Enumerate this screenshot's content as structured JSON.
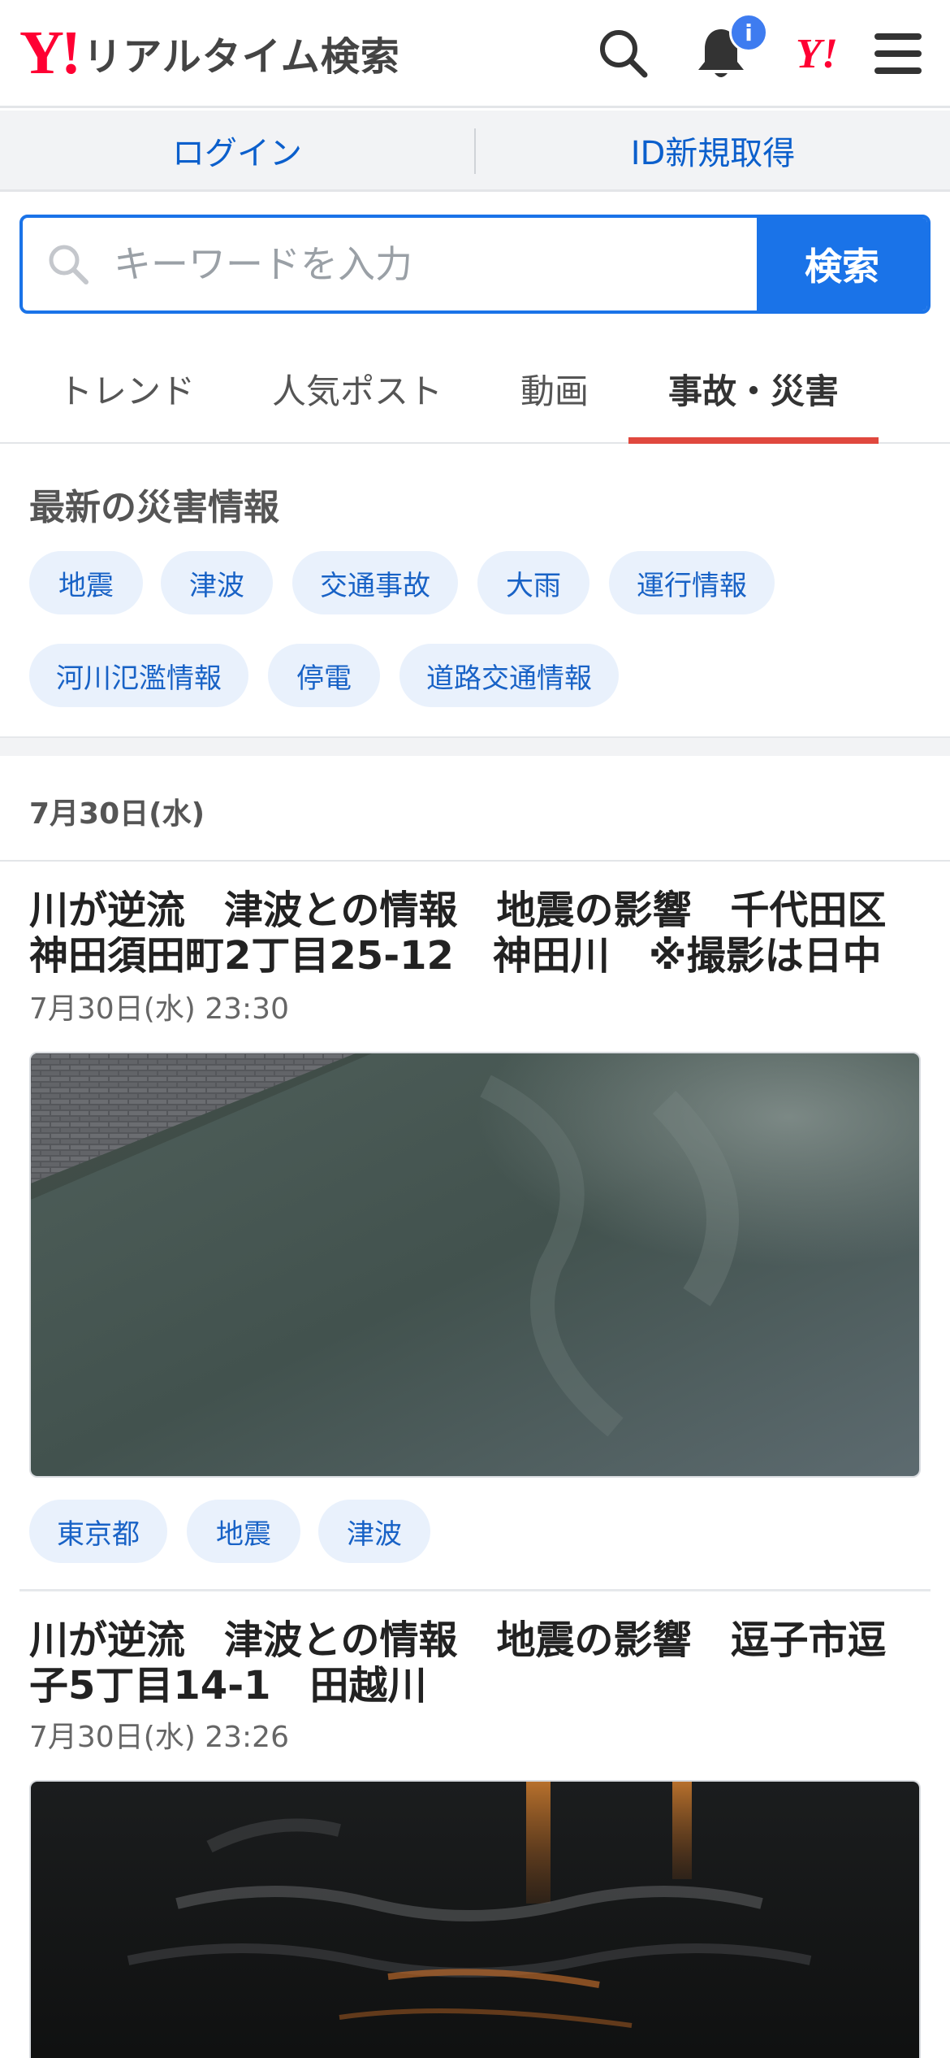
{
  "header": {
    "logo_mark": "Y!",
    "logo_text": "リアルタイム検索",
    "notification_badge": "i",
    "yahoo_mark": "Y!"
  },
  "loginbar": {
    "login": "ログイン",
    "register": "ID新規取得"
  },
  "search": {
    "placeholder": "キーワードを入力",
    "button": "検索"
  },
  "tabs": [
    {
      "label": "トレンド"
    },
    {
      "label": "人気ポスト"
    },
    {
      "label": "動画"
    },
    {
      "label": "事故・災害",
      "active": true
    }
  ],
  "disaster": {
    "title": "最新の災害情報",
    "chips": [
      "地震",
      "津波",
      "交通事故",
      "大雨",
      "運行情報",
      "河川氾濫情報",
      "停電",
      "道路交通情報"
    ]
  },
  "date_header": "7月30日(水)",
  "articles": [
    {
      "title_line1": "川が逆流　津波との情報　地震の影響　千代田区",
      "title_line2": "神田須田町2丁目25-12　神田川　※撮影は日中",
      "time": "7月30日(水) 23:30",
      "tags": [
        "東京都",
        "地震",
        "津波"
      ]
    },
    {
      "title_line1": "川が逆流　津波との情報　地震の影響　逗子市逗",
      "title_line2": "子5丁目14-1　田越川",
      "time": "7月30日(水) 23:26"
    }
  ],
  "colors": {
    "brand_red": "#ff0033",
    "link_blue": "#0b5fcc",
    "search_blue": "#1a73e8",
    "tab_active_underline": "#e0483e",
    "chip_bg": "#e9f1fc"
  },
  "icons": [
    "search-icon",
    "bell-icon",
    "menu-icon"
  ]
}
